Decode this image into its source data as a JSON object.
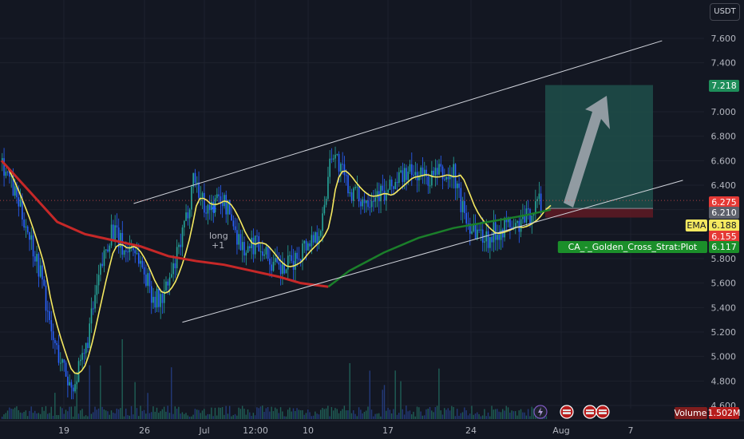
{
  "currency": "USDT",
  "colors": {
    "background": "#131722",
    "grid": "#1e222d",
    "up": "#26a69a",
    "down": "#2962ff",
    "ema_fast": "#f5e960",
    "ma_slow_below": "#c62828",
    "ma_slow_above": "#1b7f2a",
    "channel": "#d1d4dc",
    "target_zone": "#1f4f4a",
    "stop_zone": "#5b1a24",
    "arrow": "#9fa4ad",
    "price_line": "#ef5350"
  },
  "chart_data": {
    "type": "candlestick",
    "y_axis": {
      "min": 4.6,
      "max": 7.6,
      "ticks": [
        "4.600",
        "4.800",
        "5.000",
        "5.200",
        "5.400",
        "5.600",
        "5.800",
        "6.000",
        "6.200",
        "6.400",
        "6.600",
        "6.800",
        "7.000",
        "7.400",
        "7.600"
      ]
    },
    "x_axis": {
      "ticks": [
        "19",
        "26",
        "Jul",
        "12:00",
        "10",
        "17",
        "24",
        "Aug",
        "7"
      ]
    },
    "price_labels": [
      {
        "value": 7.218,
        "text": "7.218",
        "kind": "target"
      },
      {
        "value": 6.275,
        "text": "6.275",
        "kind": "last"
      },
      {
        "value": 6.21,
        "text": "6.210",
        "kind": "entry"
      },
      {
        "value": 6.188,
        "text": "6.188",
        "kind": "ema",
        "tag": "EMA"
      },
      {
        "value": 6.155,
        "text": "6.155",
        "kind": "stop"
      },
      {
        "value": 6.117,
        "text": "6.117",
        "kind": "plot",
        "tag": "CA_-_Golden_Cross_Strat:Plot"
      }
    ],
    "annotations": [
      {
        "text": "long",
        "sub": "+1",
        "x_label": "Jul"
      }
    ],
    "volume": {
      "label": "Volume",
      "value": "1.502M"
    },
    "channel": {
      "upper": [
        [
          19,
          6.25
        ],
        [
          95,
          7.58
        ]
      ],
      "lower": [
        [
          26,
          5.28
        ],
        [
          98,
          6.44
        ]
      ]
    },
    "position": {
      "entry": 6.21,
      "target": 7.218,
      "stop": 6.155
    },
    "series_keypoints": [
      [
        0,
        6.6
      ],
      [
        2,
        6.3
      ],
      [
        4,
        6.0
      ],
      [
        6,
        5.6
      ],
      [
        7,
        5.2
      ],
      [
        8,
        5.05
      ],
      [
        9,
        4.9
      ],
      [
        10,
        4.75
      ],
      [
        11,
        4.85
      ],
      [
        12,
        5.0
      ],
      [
        13,
        5.3
      ],
      [
        14,
        5.6
      ],
      [
        15,
        5.85
      ],
      [
        16,
        6.05
      ],
      [
        17,
        5.95
      ],
      [
        18,
        5.85
      ],
      [
        19,
        5.92
      ],
      [
        20,
        5.8
      ],
      [
        21,
        5.65
      ],
      [
        22,
        5.5
      ],
      [
        23,
        5.45
      ],
      [
        24,
        5.55
      ],
      [
        25,
        5.7
      ],
      [
        26,
        5.9
      ],
      [
        27,
        6.15
      ],
      [
        28,
        6.5
      ],
      [
        29,
        6.3
      ],
      [
        30,
        6.2
      ],
      [
        31,
        6.25
      ],
      [
        32,
        6.3
      ],
      [
        33,
        6.2
      ],
      [
        34,
        6.05
      ],
      [
        35,
        5.9
      ],
      [
        36,
        5.85
      ],
      [
        37,
        5.95
      ],
      [
        38,
        5.9
      ],
      [
        39,
        5.8
      ],
      [
        40,
        5.72
      ],
      [
        41,
        5.7
      ],
      [
        42,
        5.75
      ],
      [
        43,
        5.8
      ],
      [
        44,
        5.9
      ],
      [
        45,
        5.95
      ],
      [
        46,
        6.0
      ],
      [
        47,
        6.15
      ],
      [
        48,
        6.7
      ],
      [
        49,
        6.6
      ],
      [
        50,
        6.45
      ],
      [
        51,
        6.35
      ],
      [
        52,
        6.3
      ],
      [
        53,
        6.28
      ],
      [
        54,
        6.32
      ],
      [
        55,
        6.35
      ],
      [
        56,
        6.3
      ],
      [
        57,
        6.4
      ],
      [
        58,
        6.45
      ],
      [
        59,
        6.5
      ],
      [
        60,
        6.48
      ],
      [
        61,
        6.5
      ],
      [
        62,
        6.45
      ],
      [
        63,
        6.47
      ],
      [
        64,
        6.5
      ],
      [
        65,
        6.45
      ],
      [
        66,
        6.5
      ],
      [
        67,
        6.25
      ],
      [
        68,
        6.1
      ],
      [
        69,
        6.05
      ],
      [
        70,
        6.0
      ],
      [
        71,
        5.97
      ],
      [
        72,
        6.02
      ],
      [
        73,
        6.05
      ],
      [
        74,
        6.08
      ],
      [
        75,
        6.05
      ],
      [
        76,
        6.1
      ],
      [
        77,
        6.15
      ],
      [
        78,
        6.25
      ],
      [
        79,
        6.28
      ]
    ]
  }
}
